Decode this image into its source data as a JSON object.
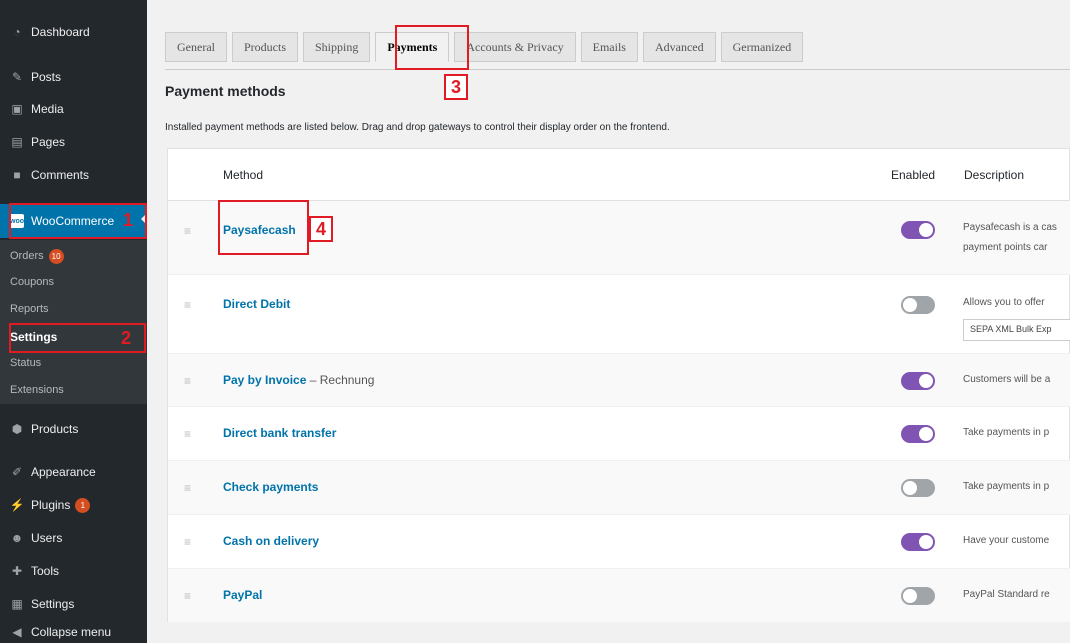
{
  "sidebar": {
    "dashboard": "Dashboard",
    "posts": "Posts",
    "media": "Media",
    "pages": "Pages",
    "comments": "Comments",
    "woocommerce": "WooCommerce",
    "woo_icon": "woo",
    "submenu": {
      "orders": "Orders",
      "orders_badge": "10",
      "coupons": "Coupons",
      "reports": "Reports",
      "settings": "Settings",
      "status": "Status",
      "extensions": "Extensions"
    },
    "products": "Products",
    "appearance": "Appearance",
    "plugins": "Plugins",
    "plugins_badge": "1",
    "users": "Users",
    "tools": "Tools",
    "settings": "Settings",
    "collapse": "Collapse menu"
  },
  "tabs": [
    "General",
    "Products",
    "Shipping",
    "Payments",
    "Accounts & Privacy",
    "Emails",
    "Advanced",
    "Germanized"
  ],
  "active_tab": "Payments",
  "section": {
    "title": "Payment methods",
    "description": "Installed payment methods are listed below. Drag and drop gateways to control their display order on the frontend."
  },
  "table": {
    "headers": {
      "method": "Method",
      "enabled": "Enabled",
      "description": "Description"
    },
    "rows": [
      {
        "name": "Paysafecash",
        "suffix": "",
        "enabled": true,
        "desc1": "Paysafecash is a cas",
        "desc2": "payment points car"
      },
      {
        "name": "Direct Debit",
        "suffix": "",
        "enabled": false,
        "desc1": "Allows you to offer",
        "select": "SEPA XML Bulk Exp"
      },
      {
        "name": "Pay by Invoice",
        "suffix": "– Rechnung",
        "enabled": true,
        "desc1": "Customers will be a"
      },
      {
        "name": "Direct bank transfer",
        "suffix": "",
        "enabled": true,
        "desc1": "Take payments in p"
      },
      {
        "name": "Check payments",
        "suffix": "",
        "enabled": false,
        "desc1": "Take payments in p"
      },
      {
        "name": "Cash on delivery",
        "suffix": "",
        "enabled": true,
        "desc1": "Have your custome"
      },
      {
        "name": "PayPal",
        "suffix": "",
        "enabled": false,
        "desc1": "PayPal Standard re"
      }
    ]
  },
  "annotations": [
    "1",
    "2",
    "3",
    "4"
  ],
  "colors": {
    "sidebar": "#23282d",
    "woo_active": "#0073aa",
    "toggle_on": "#7f54b3",
    "toggle_off": "#a0a5aa",
    "highlight": "#e01b24",
    "link": "#0073aa"
  }
}
